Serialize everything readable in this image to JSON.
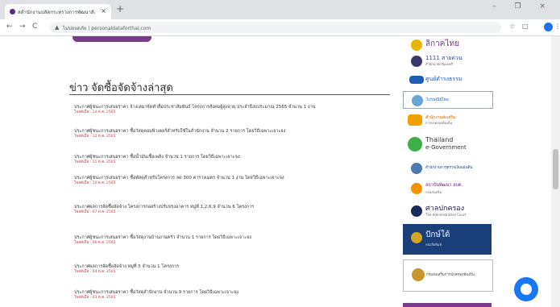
{
  "browser": {
    "tab_title": "สสำนักงานปลัดกระทรวงการพัฒนาสังคม",
    "tab_close": "×",
    "new_tab": "+",
    "window_controls": "– ❐ ×",
    "nav_back": "←",
    "nav_forward": "→",
    "nav_reload": "C",
    "lock_icon": "▲",
    "url": "ไม่ปลอดภัย | personaldataforthai.com",
    "menu": "⋮"
  },
  "main": {
    "heading": "ข่าว จัดซื้อจัดจ้างล่าสุด",
    "news": [
      {
        "title": "ประกาศผู้ชนะการเสนอราคา จ้างเหมาจัดทำสื่อประชาสัมพันธ์ โครงการสังคมผู้สูงอายุ ประจำปีงบประมาณ 2565 จำนวน 1 งาน",
        "date": "โพสต์เมื่อ : 14 ต.ค. 2565"
      },
      {
        "title": "ประกาศผู้ชนะการเสนอราคา ซื้อวัสดุคอมพิวเตอร์สำหรับใช้ในสำนักงาน จำนวน 2 รายการ โดยวิธีเฉพาะเจาะจง",
        "date": "โพสต์เมื่อ : 12 ต.ค. 2565"
      },
      {
        "title": "ประกาศผู้ชนะการเสนอราคา ซื้อน้ำมันเชื้อเพลิง จำนวน 1 รายการ โดยวิธีเฉพาะเจาะจง",
        "date": "โพสต์เมื่อ : 11 ต.ค. 2565"
      },
      {
        "title": "ประกาศผู้ชนะการเสนอราคา ซื้อพัสดุสำหรับโครงการ ลด 300 ตารางเมตร จำนวน 1 งาน โดยวิธีเฉพาะเจาะจง",
        "date": "โพสต์เมื่อ : 10 ต.ค. 2565"
      },
      {
        "title": "ประกาศผลการจัดซื้อจัดจ้าง โครงการก่อสร้างปรับปรุงอาคาร หมู่ที่ 1,2,6,9 จำนวน 6 โครงการ",
        "date": "โพสต์เมื่อ : 07 ต.ค. 2565"
      },
      {
        "title": "ประกาศผู้ชนะการเสนอราคา ซื้อวัสดุงานบ้านงานครัว จำนวน 1 รายการ โดยวิธีเฉพาะเจาะจง",
        "date": "โพสต์เมื่อ : 06 ต.ค. 2565"
      },
      {
        "title": "ประกาศผลการจัดซื้อจัดจ้าง หมู่ที่ 5 จำนวน 1 โครงการ",
        "date": "โพสต์เมื่อ : 04 ต.ค. 2565"
      },
      {
        "title": "ประกาศผู้ชนะการเสนอราคา ซื้อวัสดุสำนักงาน จำนวน 9 รายการ โดยวิธีเฉพาะเจาะจง",
        "date": "โพสต์เมื่อ : 03 ต.ค. 2565"
      }
    ]
  },
  "sidebar": {
    "links": [
      {
        "label": "ลิกาคไทย",
        "sub": ""
      },
      {
        "label": "1111 สายด่วน",
        "sub": "สำนักนายกรัฐมนตรี"
      },
      {
        "label": "ศูนย์ดำรงธรรม",
        "sub": ""
      },
      {
        "label": "ไปรษณีย์ไทย",
        "sub": ""
      },
      {
        "label": "สำนักงานส่งเสริม",
        "sub": "การปกครองท้องถิ่น"
      },
      {
        "label": "Thailand",
        "sub": "e-Government"
      },
      {
        "label": "สำนักงานการตรวจเงินแผ่นดิน",
        "sub": ""
      },
      {
        "label": "สถาบันพัฒนา อบต.",
        "sub": "กรมส่งเสริม"
      },
      {
        "label": "ศาลปกครอง",
        "sub": "The Administrative Court"
      },
      {
        "label": "ปักษ์ใต้",
        "sub": "หนังสือพิมพ์"
      },
      {
        "label": "กรมส่งเสริมการปกครองท้องถิ่น",
        "sub": ""
      }
    ]
  },
  "colors": {
    "accent": "#7b3a8a",
    "date": "#d23b3b",
    "messenger": "#1877f2"
  }
}
